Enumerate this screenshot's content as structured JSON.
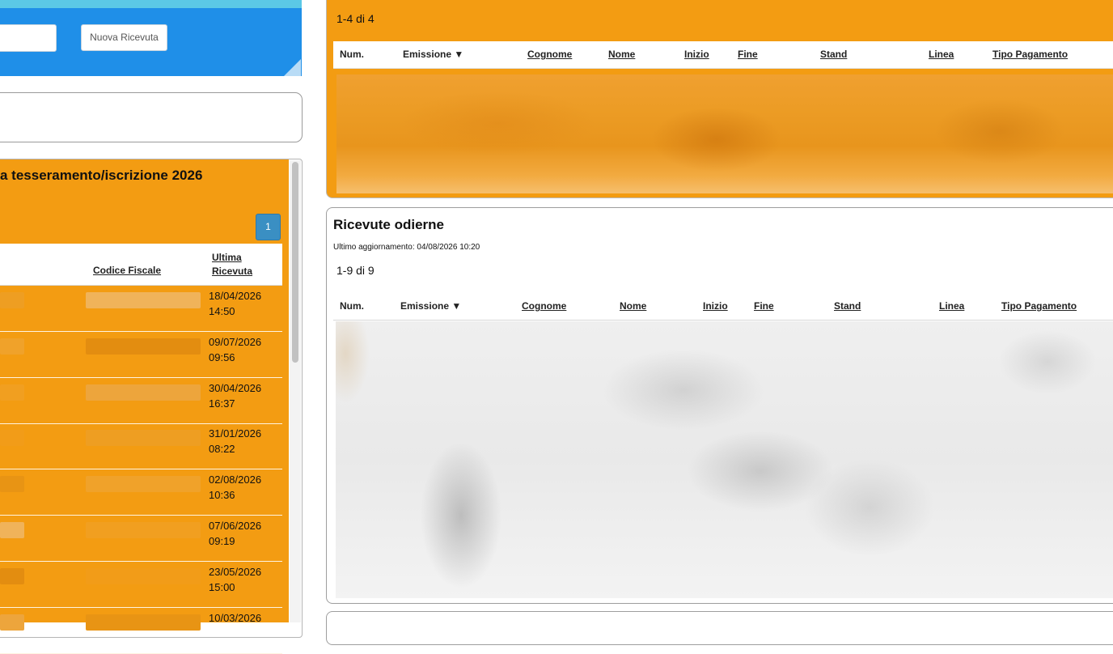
{
  "toolbar": {
    "new_receipt_label": "Nuova Ricevuta"
  },
  "left_panel": {
    "title": "a tesseramento/iscrizione 2026",
    "pagination_page": "1",
    "columns": {
      "codice_fiscale": "Codice Fiscale",
      "ultima_ricevuta": "Ultima Ricevuta"
    },
    "rows": [
      {
        "date": "18/04/2026",
        "time": "14:50"
      },
      {
        "date": "09/07/2026",
        "time": "09:56"
      },
      {
        "date": "30/04/2026",
        "time": "16:37"
      },
      {
        "date": "31/01/2026",
        "time": "08:22"
      },
      {
        "date": "02/08/2026",
        "time": "10:36"
      },
      {
        "date": "07/06/2026",
        "time": "09:19"
      },
      {
        "date": "23/05/2026",
        "time": "15:00"
      },
      {
        "date": "10/03/2026",
        "time": ""
      }
    ]
  },
  "upper_table": {
    "count": "1-4 di 4",
    "columns": [
      "Num.",
      "Emissione ▼",
      "Cognome",
      "Nome",
      "Inizio",
      "Fine",
      "Stand",
      "Linea",
      "Tipo Pagamento"
    ]
  },
  "today_receipts": {
    "title": "Ricevute odierne",
    "updated": "Ultimo aggiornamento: 04/08/2026 10:20",
    "count": "1-9 di 9",
    "columns": [
      "Num.",
      "Emissione ▼",
      "Cognome",
      "Nome",
      "Inizio",
      "Fine",
      "Stand",
      "Linea",
      "Tipo Pagamento"
    ]
  },
  "colors": {
    "accent_orange": "#f39c12",
    "header_blue": "#1f8fe8",
    "page_button_blue": "#3a8fc3"
  }
}
